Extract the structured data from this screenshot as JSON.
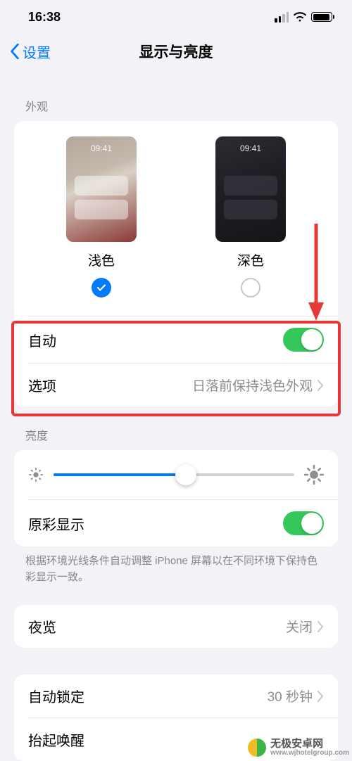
{
  "status": {
    "time": "16:38"
  },
  "nav": {
    "back": "设置",
    "title": "显示与亮度"
  },
  "appearance": {
    "header": "外观",
    "preview_time": "09:41",
    "light_label": "浅色",
    "dark_label": "深色",
    "auto_label": "自动",
    "auto_on": true,
    "options_label": "选项",
    "options_value": "日落前保持浅色外观"
  },
  "brightness": {
    "header": "亮度",
    "value_percent": 55,
    "truetone_label": "原彩显示",
    "truetone_on": true,
    "footer": "根据环境光线条件自动调整 iPhone 屏幕以在不同环境下保持色彩显示一致。"
  },
  "night_shift": {
    "label": "夜览",
    "value": "关闭"
  },
  "auto_lock": {
    "label": "自动锁定",
    "value": "30 秒钟"
  },
  "raise_wake": {
    "label": "抬起唤醒"
  },
  "watermark": {
    "brand": "无极安卓网",
    "url": "www.wjhotelgroup.com"
  }
}
